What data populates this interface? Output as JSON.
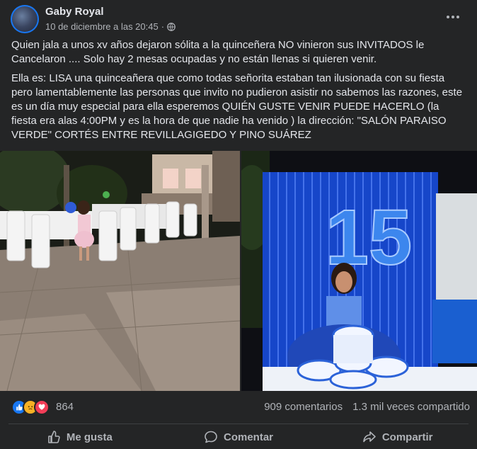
{
  "post": {
    "author": "Gaby Royal",
    "timestamp": "10 de diciembre a las 20:45",
    "separator": "·",
    "paragraph1": "Quien jala a unos xv años dejaron sólita a la quinceñera NO vinieron sus INVITADOS le Cancelaron .... Solo hay 2 mesas ocupadas y no están llenas si quieren venir.",
    "paragraph2": "Ella es: LISA una quinceañera que como todas señorita estaban tan ilusionada con su fiesta pero lamentablemente las personas que invito no pudieron asistir no sabemos las razones,  este  es un día muy especial para ella esperemos  QUIÉN GUSTE VENIR PUEDE HACERLO (la fiesta era  alas 4:00PM y es la hora de que nadie ha venido ) la  dirección: \"SALÓN PARAISO VERDE\" CORTÉS ENTRE REVILLAGIGEDO Y PINO SUÁREZ"
  },
  "photos": {
    "cake_number": "15"
  },
  "reactions": {
    "icons": [
      "like-icon",
      "sad-icon",
      "love-icon"
    ],
    "count": "864",
    "comments": "909 comentarios",
    "shares": "1.3 mil veces compartido"
  },
  "actions": {
    "like": "Me gusta",
    "comment": "Comentar",
    "share": "Compartir"
  },
  "colors": {
    "background": "#242526",
    "text": "#e4e6eb",
    "secondary_text": "#b0b3b8",
    "like_blue": "#1877f2",
    "sad_yellow": "#f7b125",
    "love_red": "#f33e58"
  }
}
